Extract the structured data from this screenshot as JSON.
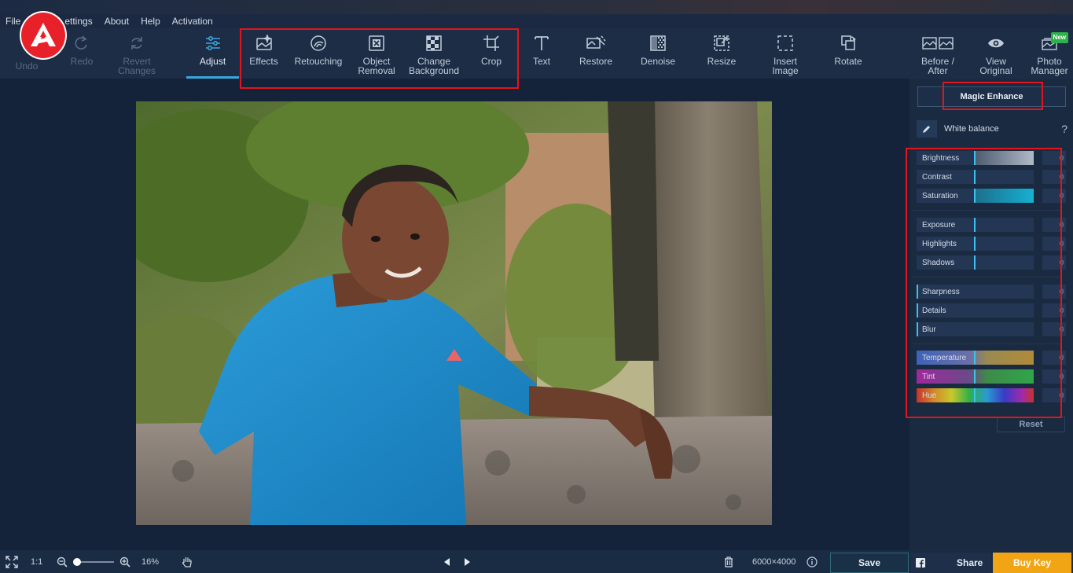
{
  "menu": {
    "items": [
      "File",
      "Settings",
      "About",
      "Help",
      "Activation"
    ],
    "partial_visible": "ettings"
  },
  "toolbar": {
    "undo": "Undo",
    "redo": "Redo",
    "revert": "Revert\nChanges",
    "adjust": "Adjust",
    "effects": "Effects",
    "retouching": "Retouching",
    "object_removal": "Object\nRemoval",
    "change_background": "Change\nBackground",
    "crop": "Crop",
    "text": "Text",
    "restore": "Restore",
    "denoise": "Denoise",
    "resize": "Resize",
    "insert_image": "Insert\nImage",
    "rotate": "Rotate",
    "before_after": "Before /\nAfter",
    "view_original": "View\nOriginal",
    "photo_manager": "Photo\nManager",
    "new_badge": "New"
  },
  "panel": {
    "magic_enhance": "Magic Enhance",
    "white_balance": "White balance",
    "help": "?",
    "sliders": [
      {
        "label": "Brightness",
        "value": "0"
      },
      {
        "label": "Contrast",
        "value": "0"
      },
      {
        "label": "Saturation",
        "value": "0"
      },
      {
        "label": "Exposure",
        "value": "0"
      },
      {
        "label": "Highlights",
        "value": "0"
      },
      {
        "label": "Shadows",
        "value": "0"
      },
      {
        "label": "Sharpness",
        "value": "0"
      },
      {
        "label": "Details",
        "value": "0"
      },
      {
        "label": "Blur",
        "value": "0"
      },
      {
        "label": "Temperature",
        "value": "0"
      },
      {
        "label": "Tint",
        "value": "0"
      },
      {
        "label": "Hue",
        "value": "0"
      }
    ],
    "reset": "Reset"
  },
  "bottom": {
    "one_to_one": "1:1",
    "zoom": "16%",
    "dimensions": "6000×4000",
    "save": "Save",
    "share": "Share",
    "buy_key": "Buy Key"
  },
  "colors": {
    "accent": "#3aa7e0",
    "highlight_box": "#e3141c",
    "buy": "#f2a514",
    "logo": "#e8202a"
  }
}
